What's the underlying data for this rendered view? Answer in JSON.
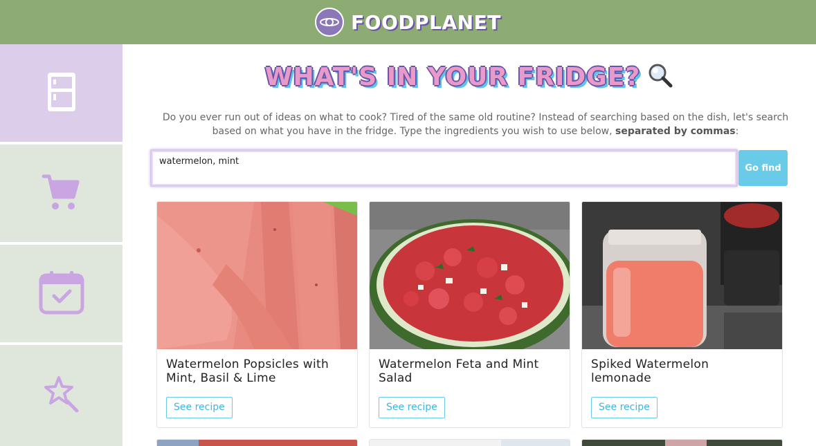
{
  "header": {
    "brand": "FOODPLANET",
    "logo_icon": "planet-plate-icon"
  },
  "sidebar": {
    "items": [
      {
        "name": "fridge",
        "icon": "fridge-icon",
        "active": true
      },
      {
        "name": "cart",
        "icon": "cart-icon",
        "active": false
      },
      {
        "name": "calendar",
        "icon": "calendar-check-icon",
        "active": false
      },
      {
        "name": "magic",
        "icon": "magic-wand-icon",
        "active": false
      }
    ]
  },
  "main": {
    "title": "WHAT'S IN YOUR FRIDGE?",
    "title_icon": "magnifier-icon",
    "intro_line1": "Do you ever run out of ideas on what to cook? Tired of the same old routine? Instead of searching based on the dish, let's search",
    "intro_line2_a": "based on what you have in the fridge. Type the ingredients you wish to use below, ",
    "intro_line2_bold": "separated by commas",
    "intro_line2_end": ":",
    "search_value": "watermelon, mint\n",
    "go_button": "Go find"
  },
  "recipes": [
    {
      "title": "Watermelon Popsicles with Mint, Basil & Lime",
      "button": "See recipe"
    },
    {
      "title": "Watermelon Feta and Mint Salad",
      "button": "See recipe"
    },
    {
      "title": "Spiked Watermelon lemonade",
      "button": "See recipe"
    }
  ],
  "colors": {
    "header_bg": "#8cac74",
    "sidebar_active": "#dccdea",
    "sidebar_inactive": "#dfe6dc",
    "icon_purple": "#c9a6e2",
    "accent_blue": "#6acbe8",
    "title_pink": "#e89ac8",
    "title_outline": "#6a52a8"
  }
}
